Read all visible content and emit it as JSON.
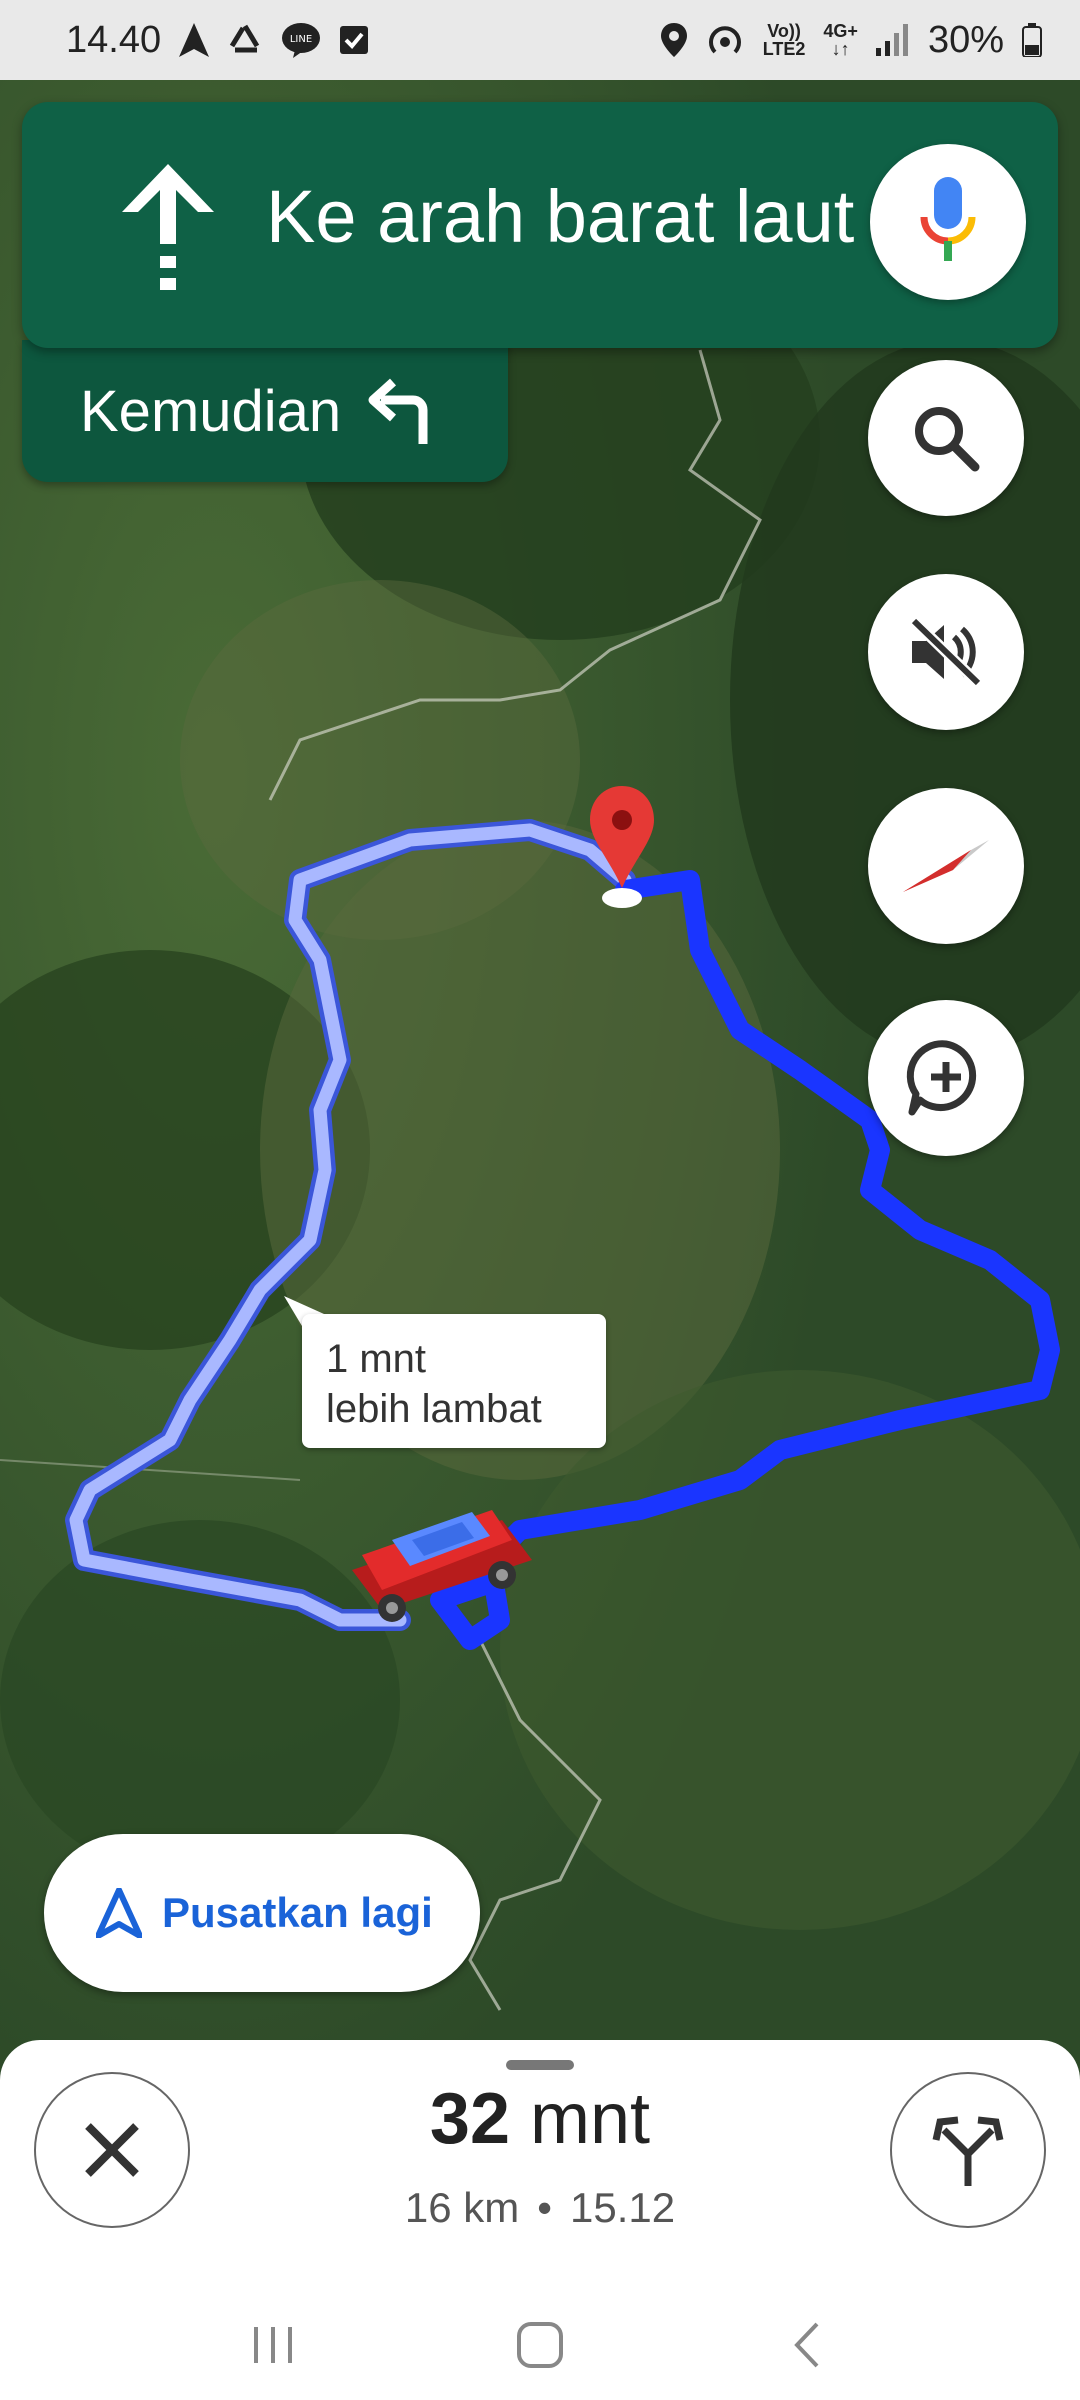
{
  "status_bar": {
    "time": "14.40",
    "battery_percent": "30%",
    "network_top": "Vo))",
    "network_bottom": "LTE2",
    "data_type": "4G+",
    "left_icons": [
      "navigation-icon",
      "recycle-icon",
      "line-app-icon",
      "checkbox-icon"
    ],
    "right_icons": [
      "location-pin-icon",
      "hotspot-icon",
      "volte-icon",
      "data-arrows-icon",
      "signal-icon",
      "battery-icon"
    ]
  },
  "navigation": {
    "instruction": "Ke arah barat laut",
    "then_label": "Kemudian",
    "direction_icon": "straight-arrow-icon",
    "then_icon": "turn-left-icon"
  },
  "map": {
    "alternative_route_note_line1": "1 mnt",
    "alternative_route_note_line2": "lebih lambat",
    "route_color": "#1a3dff",
    "alt_route_color": "#a9b8ff",
    "destination_color": "#e53935",
    "vehicle_color": "#e32b2b"
  },
  "controls": {
    "mic_icon": "microphone-icon",
    "search_icon": "search-icon",
    "mute_icon": "mute-icon",
    "compass_icon": "compass-icon",
    "report_icon": "add-report-icon"
  },
  "recenter": {
    "label": "Pusatkan lagi",
    "icon": "navigation-arrow-icon"
  },
  "trip": {
    "duration_value": "32",
    "duration_unit": "mnt",
    "distance": "16 km",
    "separator": "•",
    "arrival_time": "15.12",
    "close_icon": "close-icon",
    "alternatives_icon": "route-alternatives-icon"
  },
  "system_nav": [
    "recent-apps-icon",
    "home-icon",
    "back-icon"
  ]
}
